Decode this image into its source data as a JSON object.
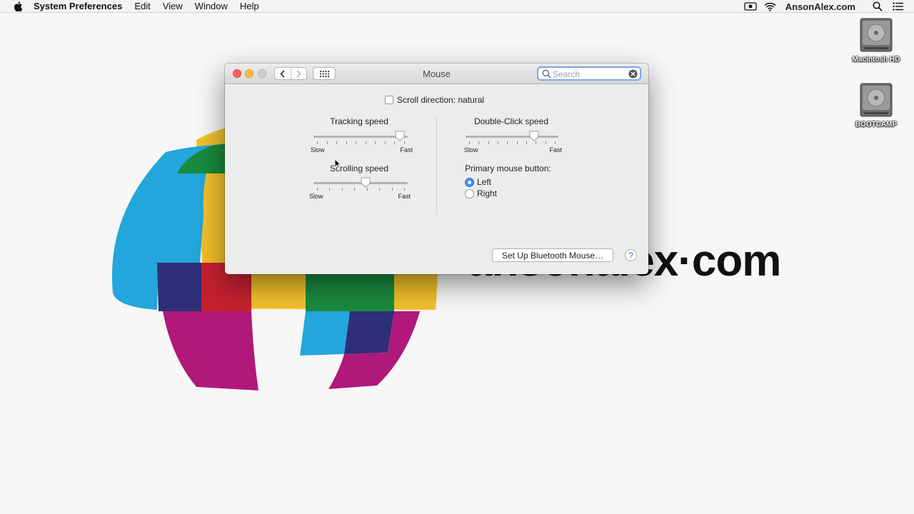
{
  "menubar": {
    "app_name": "System Preferences",
    "items": [
      "Edit",
      "View",
      "Window",
      "Help"
    ],
    "user": "AnsonAlex.com"
  },
  "desktop": {
    "logo_text": "ansonalex·com",
    "icons": [
      {
        "label": "Macintosh HD",
        "icon": "hard-drive-icon"
      },
      {
        "label": "BOOTCAMP",
        "icon": "hard-drive-icon"
      }
    ]
  },
  "window": {
    "title": "Mouse",
    "search_placeholder": "Search",
    "scroll_direction_label": "Scroll direction: natural",
    "scroll_direction_checked": false,
    "tracking": {
      "label": "Tracking speed",
      "slow": "Slow",
      "fast": "Fast",
      "value": 0.97
    },
    "scrolling": {
      "label": "Scrolling speed",
      "slow": "Slow",
      "fast": "Fast",
      "value": 0.56
    },
    "double_click": {
      "label": "Double-Click speed",
      "slow": "Slow",
      "fast": "Fast",
      "value": 0.77
    },
    "primary_button": {
      "label": "Primary mouse button:",
      "options": [
        "Left",
        "Right"
      ],
      "selected": "Left"
    },
    "bluetooth_button": "Set Up Bluetooth Mouse…",
    "help": "?"
  },
  "colors": {
    "blue": "#22a6dc",
    "yellow": "#f1c02a",
    "green": "#1a8a3e",
    "magenta": "#b0187a",
    "navy": "#2f2e78",
    "red": "#c4212f"
  }
}
